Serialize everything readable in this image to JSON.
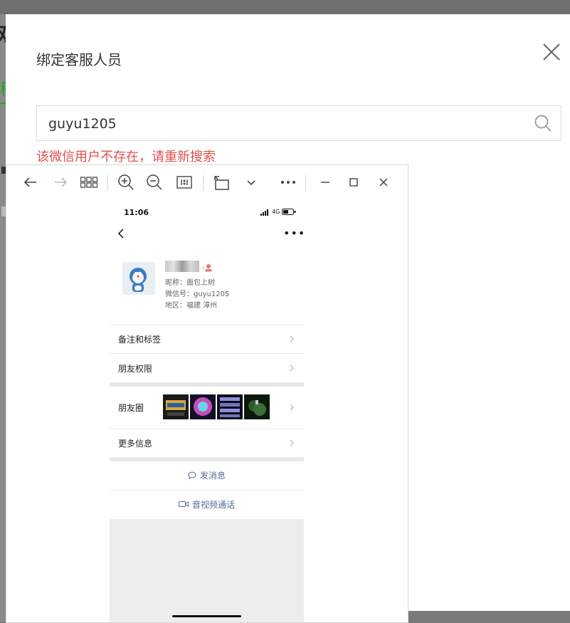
{
  "background": {
    "left_text": "双"
  },
  "modal": {
    "title": "绑定客服人员",
    "search": {
      "value": "guyu1205",
      "placeholder": ""
    },
    "error": "该微信用户不存在，请重新搜索"
  },
  "viewer": {
    "toolbar_icons": [
      "back-arrow-icon",
      "forward-arrow-icon",
      "grid-icon",
      "zoom-in-icon",
      "zoom-out-icon",
      "actual-size-icon",
      "rotate-icon",
      "chevron-down-icon",
      "more-icon",
      "minimize-icon",
      "maximize-icon",
      "close-icon"
    ]
  },
  "phone": {
    "status_time": "11:06",
    "network": "4G",
    "profile": {
      "name_suffix": ".",
      "nickname": "昵称：面包上树",
      "wechat_id": "微信号：guyu1205",
      "region": "地区：福建 漳州"
    },
    "menu": {
      "remarks": "备注和标签",
      "permissions": "朋友权限",
      "moments": "朋友圈",
      "more_info": "更多信息"
    },
    "actions": {
      "message": "发消息",
      "video_call": "音视频通话"
    }
  },
  "colors": {
    "error": "#e24f4f",
    "link": "#576b95",
    "accent_green": "#1aad19"
  }
}
